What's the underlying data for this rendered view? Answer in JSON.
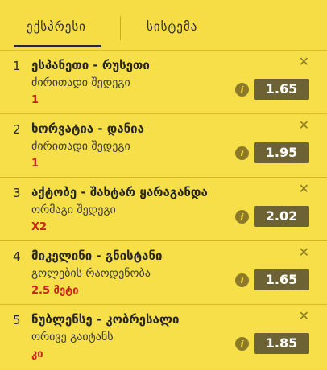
{
  "tabs": [
    {
      "label": "ექსპრესი",
      "active": true
    },
    {
      "label": "სისტემა",
      "active": false
    }
  ],
  "close_icon": "close-icon",
  "info_icon": "info-icon",
  "info_glyph": "i",
  "bets": [
    {
      "number": "1",
      "match": "ესპანეთი - რუსეთი",
      "market": "ძირითადი შედეგი",
      "selection": "1",
      "odds": "1.65"
    },
    {
      "number": "2",
      "match": "ხორვატია - დანია",
      "market": "ძირითადი შედეგი",
      "selection": "1",
      "odds": "1.95"
    },
    {
      "number": "3",
      "match": "აქტობე - შახტარ ყარაგანდა",
      "market": "ორმაგი შედეგი",
      "selection": "X2",
      "odds": "2.02"
    },
    {
      "number": "4",
      "match": "მიკელინი - გნისტანი",
      "market": "გოლების რაოდენობა",
      "selection": "2.5 მეტი",
      "odds": "1.65"
    },
    {
      "number": "5",
      "match": "ნუბლენსე - კობრესალი",
      "market": "ორივე გაიტანს",
      "selection": "კი",
      "odds": "1.85"
    }
  ],
  "colors": {
    "background": "#f6dd45",
    "odds_button": "#6d6233",
    "selection_text": "#c8231c"
  }
}
